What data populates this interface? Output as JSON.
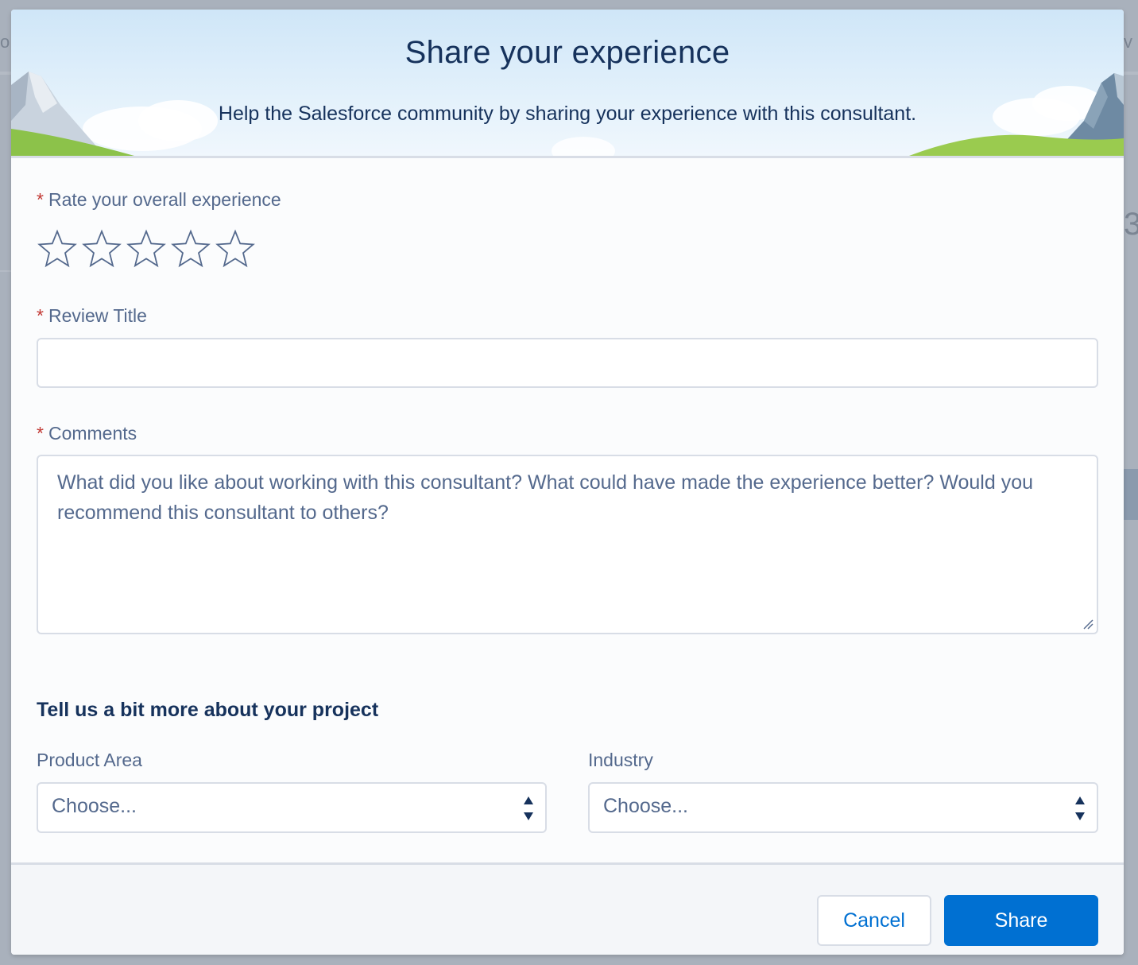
{
  "modal": {
    "title": "Share your experience",
    "subtitle": "Help the Salesforce community by sharing your experience with this consultant."
  },
  "rating": {
    "label": "Rate your overall experience",
    "required_mark": "*",
    "value": 0,
    "max": 5
  },
  "review_title": {
    "label": "Review Title",
    "required_mark": "*",
    "value": ""
  },
  "comments": {
    "label": "Comments",
    "required_mark": "*",
    "placeholder": "What did you like about working with this consultant? What could have made the experience better? Would you recommend this consultant to others?"
  },
  "project": {
    "heading": "Tell us a bit more about your project",
    "product_area": {
      "label": "Product Area",
      "value": "Choose..."
    },
    "industry": {
      "label": "Industry",
      "value": "Choose..."
    }
  },
  "footer": {
    "cancel_label": "Cancel",
    "share_label": "Share"
  },
  "colors": {
    "brand": "#0070d2",
    "title": "#16325c",
    "label": "#54698d",
    "required": "#c23934"
  }
}
